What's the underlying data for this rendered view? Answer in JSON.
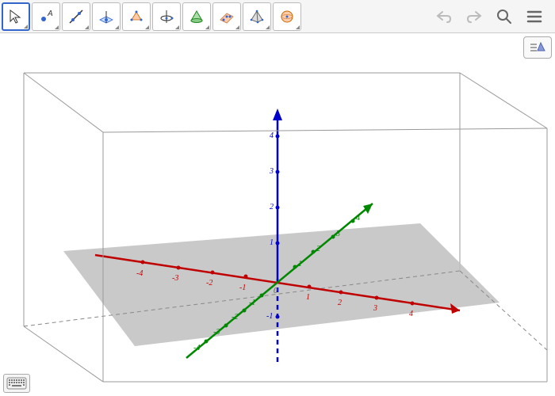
{
  "toolbar": {
    "tools": [
      {
        "name": "move",
        "selected": true
      },
      {
        "name": "point",
        "selected": false
      },
      {
        "name": "line",
        "selected": false
      },
      {
        "name": "perpendicular-plane",
        "selected": false
      },
      {
        "name": "polygon",
        "selected": false
      },
      {
        "name": "circle-axis",
        "selected": false
      },
      {
        "name": "intersect-surfaces",
        "selected": false
      },
      {
        "name": "plane",
        "selected": false
      },
      {
        "name": "pyramid",
        "selected": false
      },
      {
        "name": "sphere",
        "selected": false
      }
    ],
    "actions": {
      "undo": "↶",
      "redo": "↷",
      "search": "search",
      "menu": "menu"
    }
  },
  "view": {
    "axes": {
      "x": {
        "color": "#c00000",
        "ticks": [
          -4,
          -3,
          -2,
          -1,
          1,
          2,
          3,
          4
        ]
      },
      "y": {
        "color": "#008800",
        "ticks": [
          -4,
          -3,
          -2,
          -1,
          1,
          2,
          3,
          4
        ]
      },
      "z": {
        "color": "#0000cc",
        "ticks": [
          -1,
          1,
          2,
          3,
          4
        ]
      },
      "origin_label": "0"
    },
    "plane_color": "#bfbfbf"
  },
  "chart_data": {
    "type": "3d-coordinate-system",
    "x_range": [
      -5,
      5
    ],
    "y_range": [
      -5,
      5
    ],
    "z_range": [
      -2,
      5
    ],
    "plane": "xy",
    "series": []
  }
}
